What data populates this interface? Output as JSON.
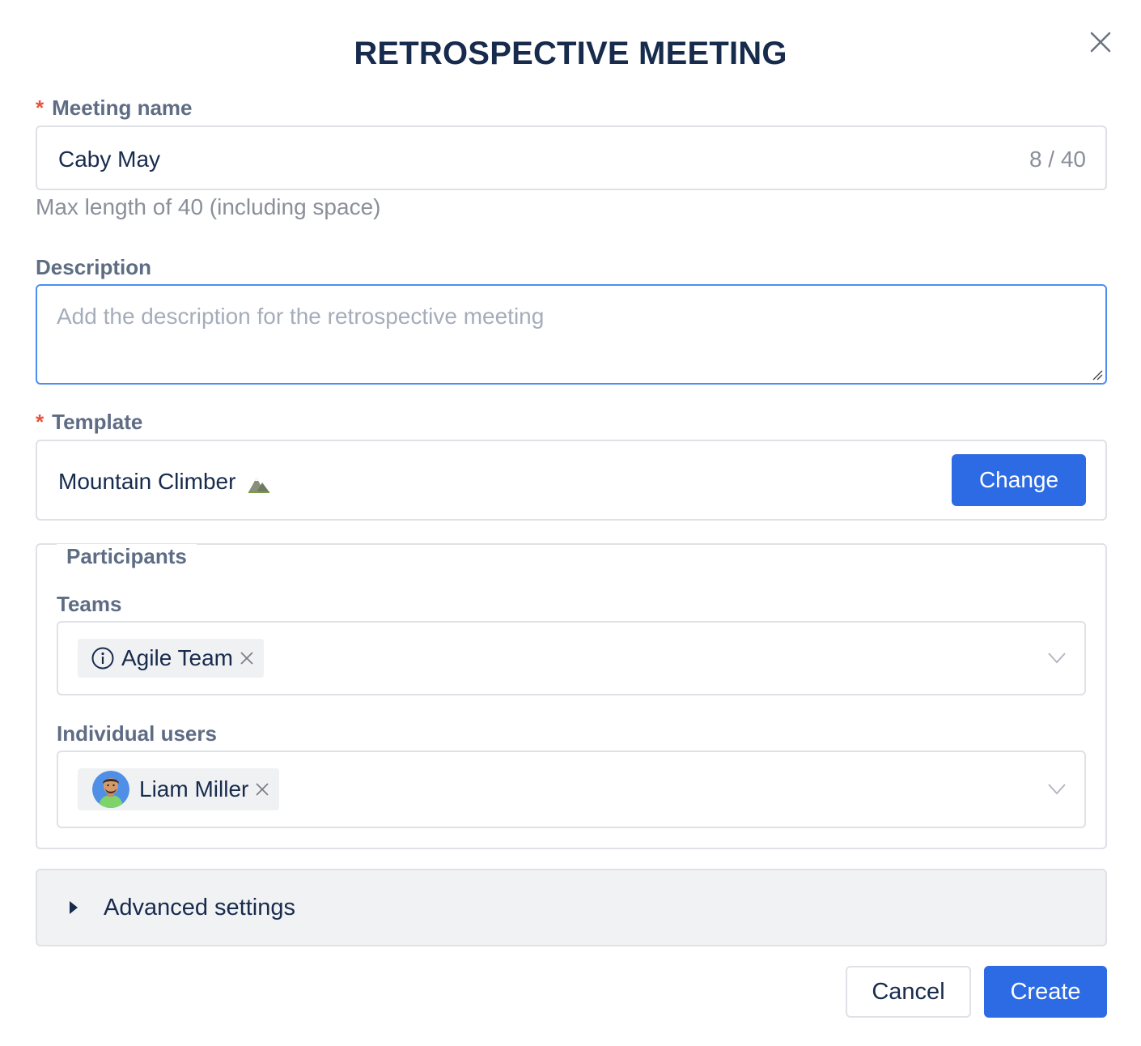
{
  "dialog": {
    "title": "RETROSPECTIVE MEETING",
    "close_icon": "close-icon"
  },
  "meeting_name": {
    "required_mark": "*",
    "label": "Meeting name",
    "value": "Caby May",
    "counter": "8 / 40",
    "help": "Max length of 40 (including space)"
  },
  "description": {
    "label": "Description",
    "placeholder": "Add the description for the retrospective meeting",
    "value": ""
  },
  "template": {
    "required_mark": "*",
    "label": "Template",
    "value": "Mountain Climber",
    "icon": "mountain-icon",
    "change_label": "Change"
  },
  "participants": {
    "legend": "Participants",
    "teams": {
      "label": "Teams",
      "chips": [
        {
          "label": "Agile Team",
          "icon": "info-icon"
        }
      ]
    },
    "individual_users": {
      "label": "Individual users",
      "chips": [
        {
          "label": "Liam Miller",
          "icon": "avatar"
        }
      ]
    }
  },
  "advanced": {
    "label": "Advanced settings"
  },
  "footer": {
    "cancel_label": "Cancel",
    "create_label": "Create"
  },
  "colors": {
    "primary": "#2d6be4",
    "required": "#e5533d",
    "label": "#5e6c84",
    "focus_border": "#4c8ef0"
  }
}
